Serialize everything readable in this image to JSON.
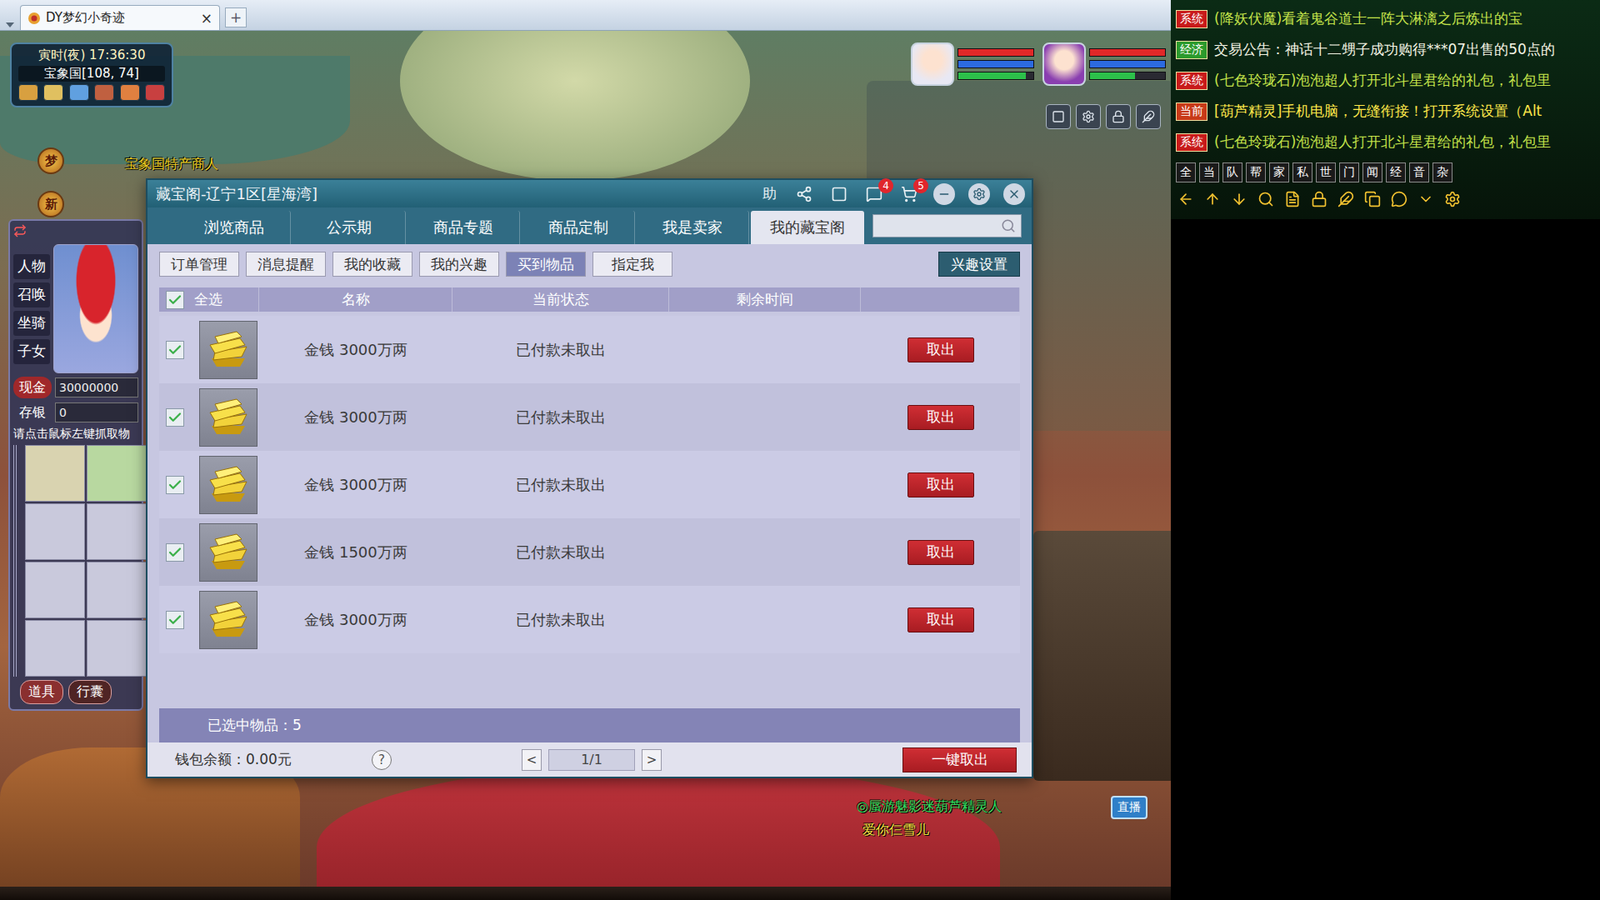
{
  "browser": {
    "tab_title": "DY梦幻小奇迹",
    "close": "×",
    "new_tab": "+"
  },
  "hud": {
    "time": "寅时(夜)  17:36:30",
    "location": "宝象国[108, 74]",
    "quick_buttons": [
      "梦",
      "新"
    ]
  },
  "party": [
    {
      "hp": 1,
      "mp": 1,
      "sp": 0.9
    },
    {
      "hp": 1,
      "mp": 1,
      "sp": 0.6
    }
  ],
  "character_panel": {
    "menu": [
      "人物",
      "召唤",
      "坐骑",
      "子女"
    ],
    "cash_label": "现金",
    "cash": "30000000",
    "savings_label": "存银",
    "savings": "0",
    "hint": "请点击鼠标左键抓取物",
    "bag_tabs": [
      {
        "label": "道具",
        "selected": true
      },
      {
        "label": "行囊",
        "selected": false
      }
    ]
  },
  "scene_labels": [
    {
      "text": "宝象国特产商人",
      "color": "#f0d020"
    },
    {
      "text": "◎蜃游魅影迷葫芦精灵人",
      "color": "#30e060"
    },
    {
      "text": "爱你仨雪儿",
      "color": "#f0e040"
    }
  ],
  "live_button": "直播",
  "dialog": {
    "title": "藏宝阁-辽宁1区[星海湾]",
    "help": "助",
    "message_badge": "4",
    "cart_badge": "5",
    "tabs": [
      {
        "label": "浏览商品",
        "selected": false
      },
      {
        "label": "公示期",
        "selected": false
      },
      {
        "label": "商品专题",
        "selected": false
      },
      {
        "label": "商品定制",
        "selected": false
      },
      {
        "label": "我是卖家",
        "selected": false
      },
      {
        "label": "我的藏宝阁",
        "selected": true
      }
    ],
    "subtabs": [
      {
        "label": "订单管理",
        "selected": false
      },
      {
        "label": "消息提醒",
        "selected": false
      },
      {
        "label": "我的收藏",
        "selected": false
      },
      {
        "label": "我的兴趣",
        "selected": false
      },
      {
        "label": "买到物品",
        "selected": true
      },
      {
        "label": "指定我",
        "selected": false
      }
    ],
    "interest_button": "兴趣设置",
    "table": {
      "select_all": {
        "label": "全选",
        "checked": true
      },
      "columns": [
        "名称",
        "当前状态",
        "剩余时间"
      ],
      "rows": [
        {
          "name": "金钱 3000万两",
          "status": "已付款未取出",
          "action": "取出",
          "checked": true
        },
        {
          "name": "金钱 3000万两",
          "status": "已付款未取出",
          "action": "取出",
          "checked": true
        },
        {
          "name": "金钱 3000万两",
          "status": "已付款未取出",
          "action": "取出",
          "checked": true
        },
        {
          "name": "金钱 1500万两",
          "status": "已付款未取出",
          "action": "取出",
          "checked": true
        },
        {
          "name": "金钱 3000万两",
          "status": "已付款未取出",
          "action": "取出",
          "checked": true
        }
      ]
    },
    "selected_count": "已选中物品：5",
    "wallet": "钱包余额：0.00元",
    "help_mark": "?",
    "pager": {
      "prev": "<",
      "page": "1/1",
      "next": ">"
    },
    "take_all": "一键取出"
  },
  "chat": {
    "lines": [
      {
        "tag": "系统",
        "tag_color": "#c81a1a",
        "text": "(降妖伏魔)看着鬼谷道士一阵大淋漓之后炼出的宝",
        "color": "#c4e24a"
      },
      {
        "tag": "经济",
        "tag_color": "#2c9a2c",
        "text": "交易公告：神话十二甥子成功购得***07出售的50点的",
        "color": "#f4f4e4"
      },
      {
        "tag": "系统",
        "tag_color": "#c81a1a",
        "text": "(七色玲珑石)泡泡超人打开北斗星君给的礼包，礼包里",
        "color": "#c4e24a"
      },
      {
        "tag": "当前",
        "tag_color": "#c83a18",
        "text": "[葫芦精灵]手机电脑，无缝衔接！打开系统设置（Alt",
        "color": "#ffe84a"
      },
      {
        "tag": "系统",
        "tag_color": "#c81a1a",
        "text": "(七色玲珑石)泡泡超人打开北斗星君给的礼包，礼包里",
        "color": "#c4e24a"
      }
    ],
    "channels": [
      "全",
      "当",
      "队",
      "帮",
      "家",
      "私",
      "世",
      "门",
      "闻",
      "经",
      "音",
      "杂"
    ]
  }
}
